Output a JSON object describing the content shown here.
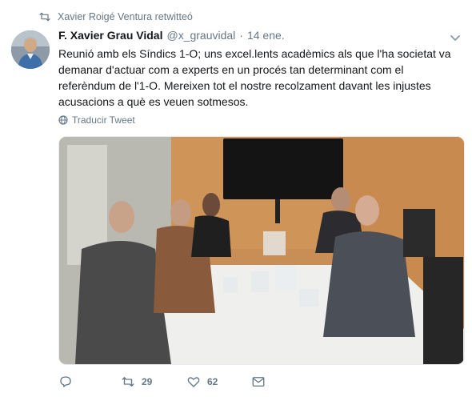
{
  "context": {
    "retweeted_by": "Xavier Roigé Ventura retwitteó"
  },
  "tweet": {
    "name": "F. Xavier Grau Vidal",
    "handle": "@x_grauvidal",
    "separator": "·",
    "date": "14 ene.",
    "text": "Reunió amb els Síndics 1-O; uns excel.lents acadèmics als que l'ha societat va\ndemanar d'actuar com a experts en un procés tan determinant com el\nreferèndum de l'1-O. Mereixen tot el nostre recolzament davant les injustes\nacusacions a què es veuen sotmesos.",
    "translate_label": "Traducir Tweet"
  },
  "actions": {
    "retweets": "29",
    "likes": "62"
  },
  "colors": {
    "text": "#14171a",
    "secondary": "#657786"
  },
  "icons": [
    "retweet-icon",
    "chevron-down-icon",
    "globe-icon",
    "reply-icon",
    "heart-icon",
    "message-icon"
  ]
}
